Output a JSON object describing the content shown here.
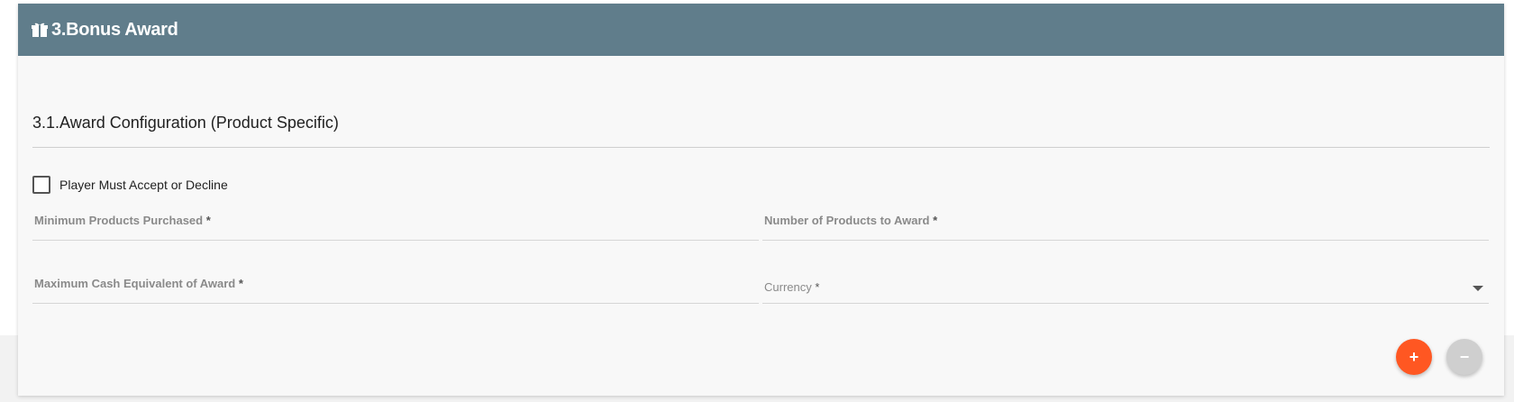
{
  "card": {
    "icon": "gift-icon",
    "title": "3.Bonus Award",
    "header_color": "#607d8b"
  },
  "section": {
    "title": "3.1.Award Configuration (Product Specific)"
  },
  "checkbox": {
    "label": "Player Must Accept or Decline",
    "checked": false
  },
  "fields": {
    "min_products": {
      "label": "Minimum Products Purchased",
      "required": "*",
      "value": ""
    },
    "num_products": {
      "label": "Number of Products to Award",
      "required": "*",
      "value": ""
    },
    "max_cash": {
      "label": "Maximum Cash Equivalent of Award",
      "required": "*",
      "value": ""
    },
    "currency": {
      "label": "Currency",
      "required": "*",
      "selected": ""
    }
  },
  "actions": {
    "add_label": "+",
    "remove_label": "−",
    "add_color": "#ff5722",
    "remove_color": "#cfcfcf"
  }
}
